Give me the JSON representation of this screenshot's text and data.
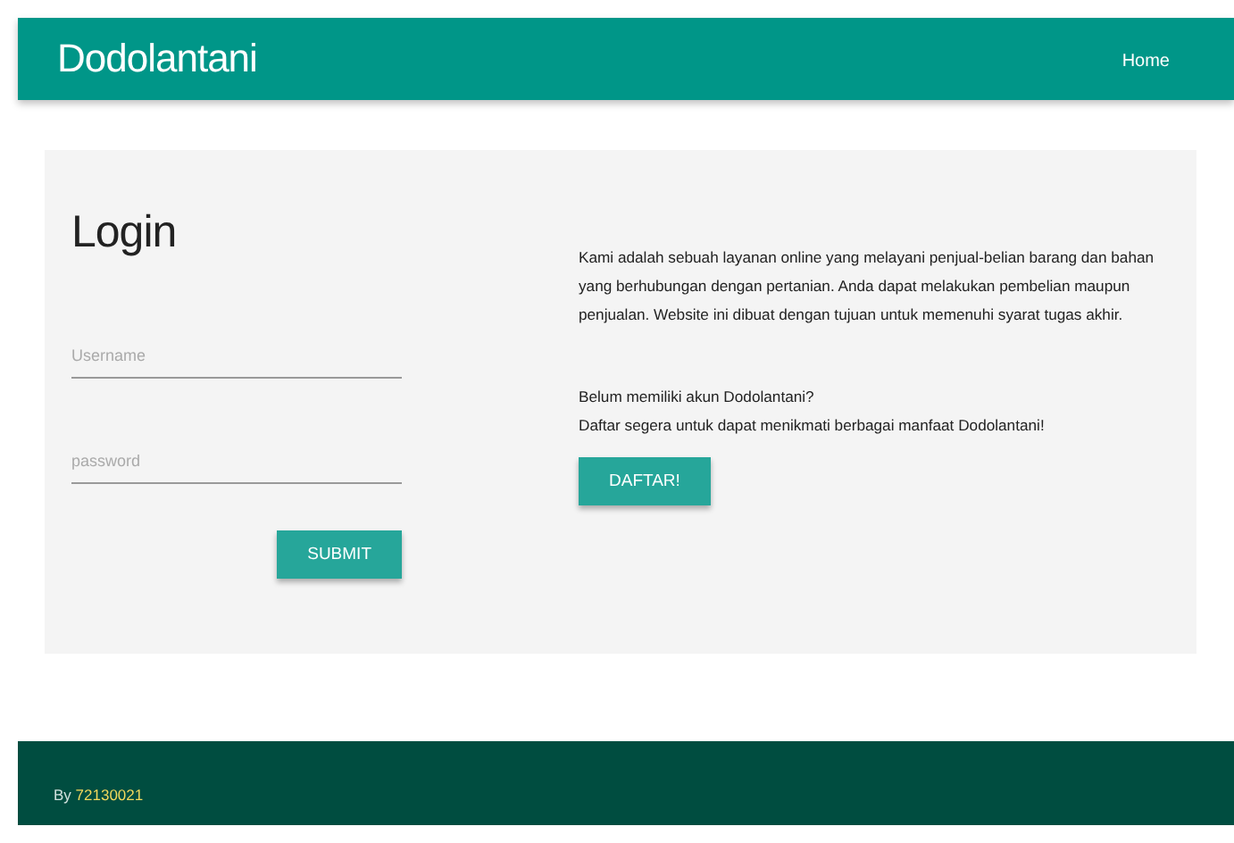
{
  "navbar": {
    "brand": "Dodolantani",
    "links": [
      "Home"
    ]
  },
  "login": {
    "title": "Login",
    "fields": [
      {
        "placeholder": "Username"
      },
      {
        "placeholder": "password"
      }
    ],
    "submit": "SUBMIT"
  },
  "info": {
    "about": "Kami adalah sebuah layanan online yang melayani penjual-belian barang dan bahan yang berhubungan dengan pertanian. Anda dapat melakukan pembelian maupun penjualan. Website ini dibuat dengan tujuan untuk memenuhi syarat tugas akhir.",
    "question": "Belum memiliki akun Dodolantani?",
    "invite": "Daftar segera untuk dapat menikmati berbagai manfaat Dodolantani!",
    "register": "DAFTAR!"
  },
  "footer": {
    "prefix": "By",
    "link": "72130021"
  }
}
